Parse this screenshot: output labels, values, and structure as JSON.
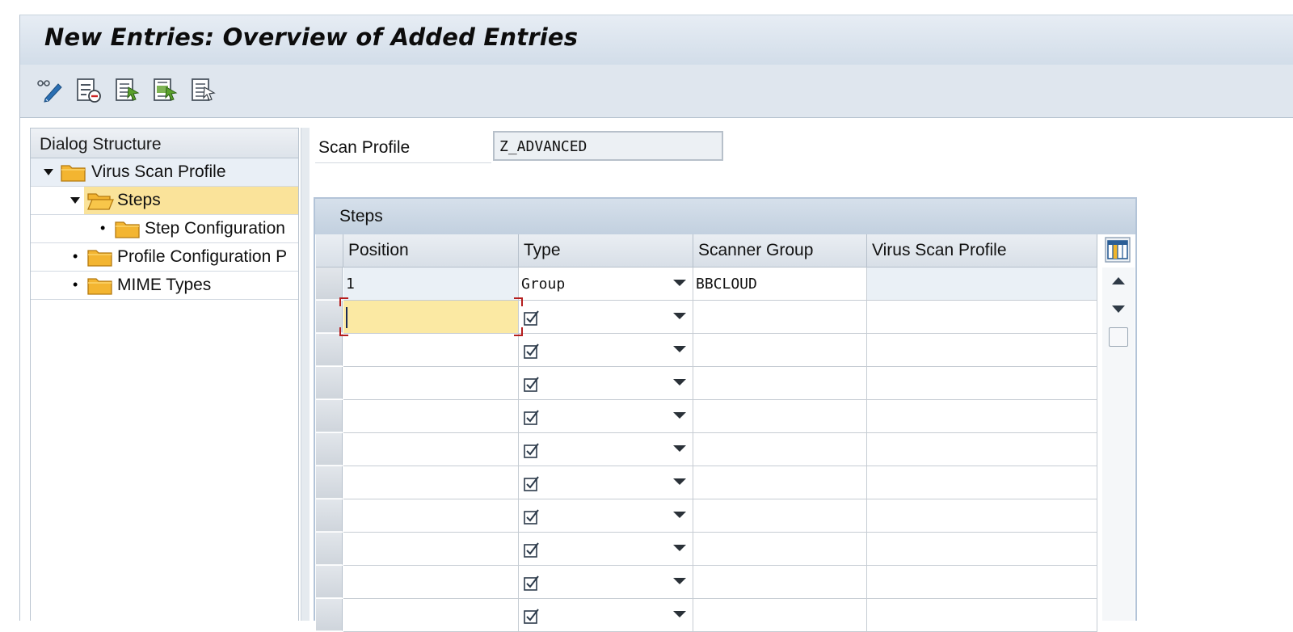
{
  "window": {
    "title": "New Entries: Overview of Added Entries"
  },
  "toolbar": {
    "buttons": [
      {
        "icon": "display-change-icon"
      },
      {
        "icon": "delete-row-icon"
      },
      {
        "icon": "select-all-icon"
      },
      {
        "icon": "select-block-icon"
      },
      {
        "icon": "deselect-all-icon"
      }
    ]
  },
  "dialog_structure": {
    "header": "Dialog Structure",
    "items": [
      {
        "label": "Virus Scan Profile",
        "expanded": true,
        "icon": "folder-icon"
      },
      {
        "label": "Steps",
        "expanded": true,
        "selected": true,
        "icon": "open-folder-icon"
      },
      {
        "label": "Step Configuration",
        "icon": "folder-icon"
      },
      {
        "label": "Profile Configuration P",
        "icon": "folder-icon"
      },
      {
        "label": "MIME Types",
        "icon": "folder-icon"
      }
    ]
  },
  "scan_profile": {
    "label": "Scan Profile",
    "value": "Z_ADVANCED"
  },
  "steps": {
    "title": "Steps",
    "columns": [
      "Position",
      "Type",
      "Scanner Group",
      "Virus Scan Profile"
    ],
    "rows": [
      {
        "position": "1",
        "type": "Group",
        "scanner_group": "BBCLOUD",
        "virus_scan_profile": ""
      }
    ],
    "empty_rows": 9
  },
  "colors": {
    "title_bg": "#d2dde9",
    "selection": "#fae39a",
    "focus_cell": "#fbe9a3",
    "table_border": "#b3c4d8",
    "focus_frame": "#b51e1e"
  }
}
